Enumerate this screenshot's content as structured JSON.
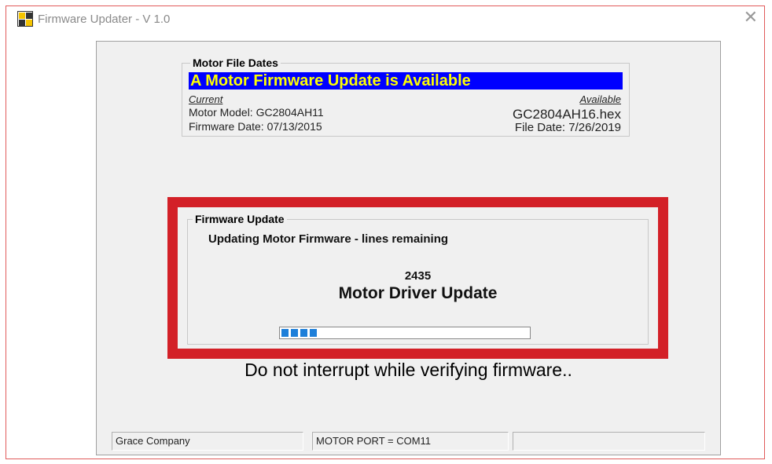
{
  "window": {
    "title": "Firmware Updater - V 1.0",
    "close_symbol": "✕",
    "icon": "app-grid-icon"
  },
  "motor_file_dates": {
    "legend": "Motor File Dates",
    "banner": "A Motor Firmware Update is Available",
    "current_label": "Current",
    "available_label": "Available",
    "motor_model": "Motor Model: GC2804AH11",
    "firmware_date": "Firmware Date: 07/13/2015",
    "available_file": "GC2804AH16.hex",
    "available_file_date": "File Date: 7/26/2019"
  },
  "firmware_update": {
    "legend": "Firmware Update",
    "status": "Updating Motor Firmware - lines remaining",
    "lines_remaining": "2435",
    "driver_label": "Motor Driver Update",
    "progress_segments": 4
  },
  "warning": "Do not interrupt while verifying firmware..",
  "status_bar": {
    "company": "Grace Company",
    "port": "MOTOR PORT = COM11",
    "extra": ""
  },
  "colors": {
    "banner_bg": "#0000ff",
    "banner_text": "#ffff00",
    "highlight_frame": "#d32027",
    "progress_fill": "#1e7fd9"
  }
}
